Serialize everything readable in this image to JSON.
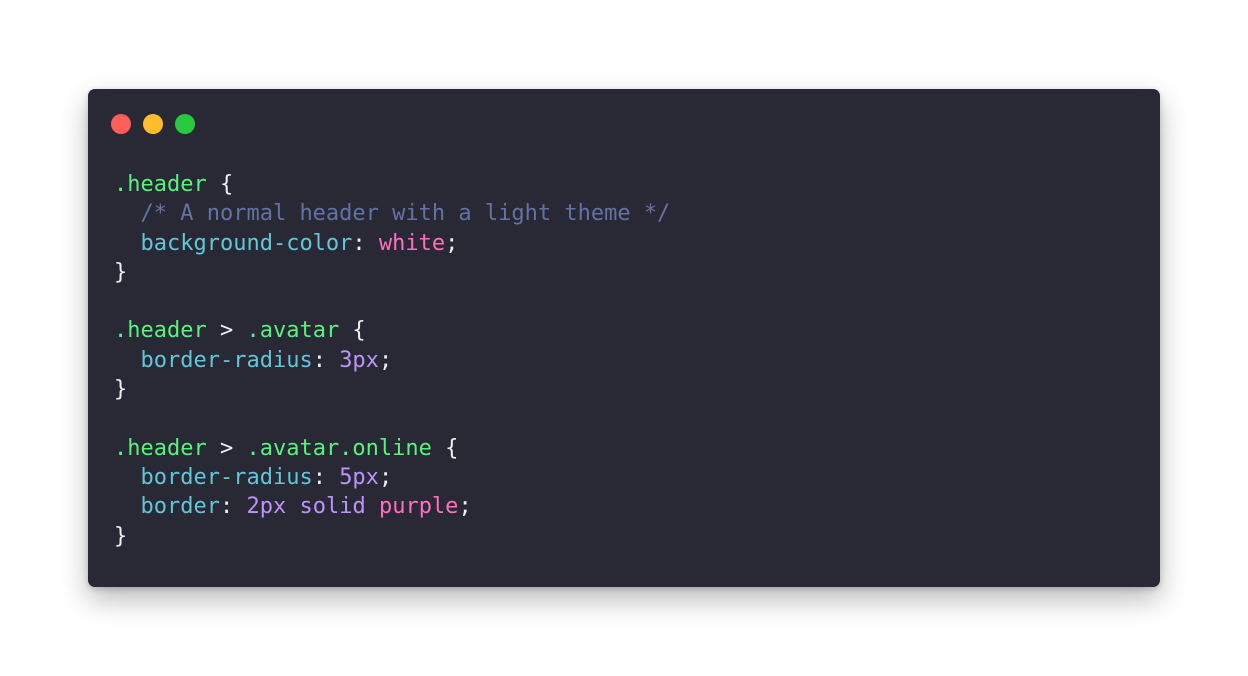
{
  "window": {
    "controls": [
      {
        "name": "close",
        "color": "#ff5f56"
      },
      {
        "name": "minimize",
        "color": "#ffbd2e"
      },
      {
        "name": "zoom",
        "color": "#27c93f"
      }
    ],
    "background": "#282935"
  },
  "theme": {
    "selector": "#5af27c",
    "comment": "#6272a4",
    "property": "#62c6d8",
    "keyword": "#ff6ec0",
    "number": "#bd93f9",
    "punctuation": "#eeeeee"
  },
  "code": {
    "language": "css",
    "lines": [
      [
        {
          "t": "selector",
          "v": ".header"
        },
        {
          "t": "punct",
          "v": " {"
        }
      ],
      [
        {
          "t": "punct",
          "v": "  "
        },
        {
          "t": "comment",
          "v": "/* A normal header with a light theme */"
        }
      ],
      [
        {
          "t": "punct",
          "v": "  "
        },
        {
          "t": "prop",
          "v": "background-color"
        },
        {
          "t": "punct",
          "v": ": "
        },
        {
          "t": "keyword",
          "v": "white"
        },
        {
          "t": "punct",
          "v": ";"
        }
      ],
      [
        {
          "t": "punct",
          "v": "}"
        }
      ],
      [],
      [
        {
          "t": "selector",
          "v": ".header"
        },
        {
          "t": "punct",
          "v": " > "
        },
        {
          "t": "selector",
          "v": ".avatar"
        },
        {
          "t": "punct",
          "v": " {"
        }
      ],
      [
        {
          "t": "punct",
          "v": "  "
        },
        {
          "t": "prop",
          "v": "border-radius"
        },
        {
          "t": "punct",
          "v": ": "
        },
        {
          "t": "number",
          "v": "3px"
        },
        {
          "t": "punct",
          "v": ";"
        }
      ],
      [
        {
          "t": "punct",
          "v": "}"
        }
      ],
      [],
      [
        {
          "t": "selector",
          "v": ".header"
        },
        {
          "t": "punct",
          "v": " > "
        },
        {
          "t": "selector",
          "v": ".avatar.online"
        },
        {
          "t": "punct",
          "v": " {"
        }
      ],
      [
        {
          "t": "punct",
          "v": "  "
        },
        {
          "t": "prop",
          "v": "border-radius"
        },
        {
          "t": "punct",
          "v": ": "
        },
        {
          "t": "number",
          "v": "5px"
        },
        {
          "t": "punct",
          "v": ";"
        }
      ],
      [
        {
          "t": "punct",
          "v": "  "
        },
        {
          "t": "prop",
          "v": "border"
        },
        {
          "t": "punct",
          "v": ": "
        },
        {
          "t": "number",
          "v": "2px solid"
        },
        {
          "t": "punct",
          "v": " "
        },
        {
          "t": "keyword",
          "v": "purple"
        },
        {
          "t": "punct",
          "v": ";"
        }
      ],
      [
        {
          "t": "punct",
          "v": "}"
        }
      ]
    ]
  }
}
